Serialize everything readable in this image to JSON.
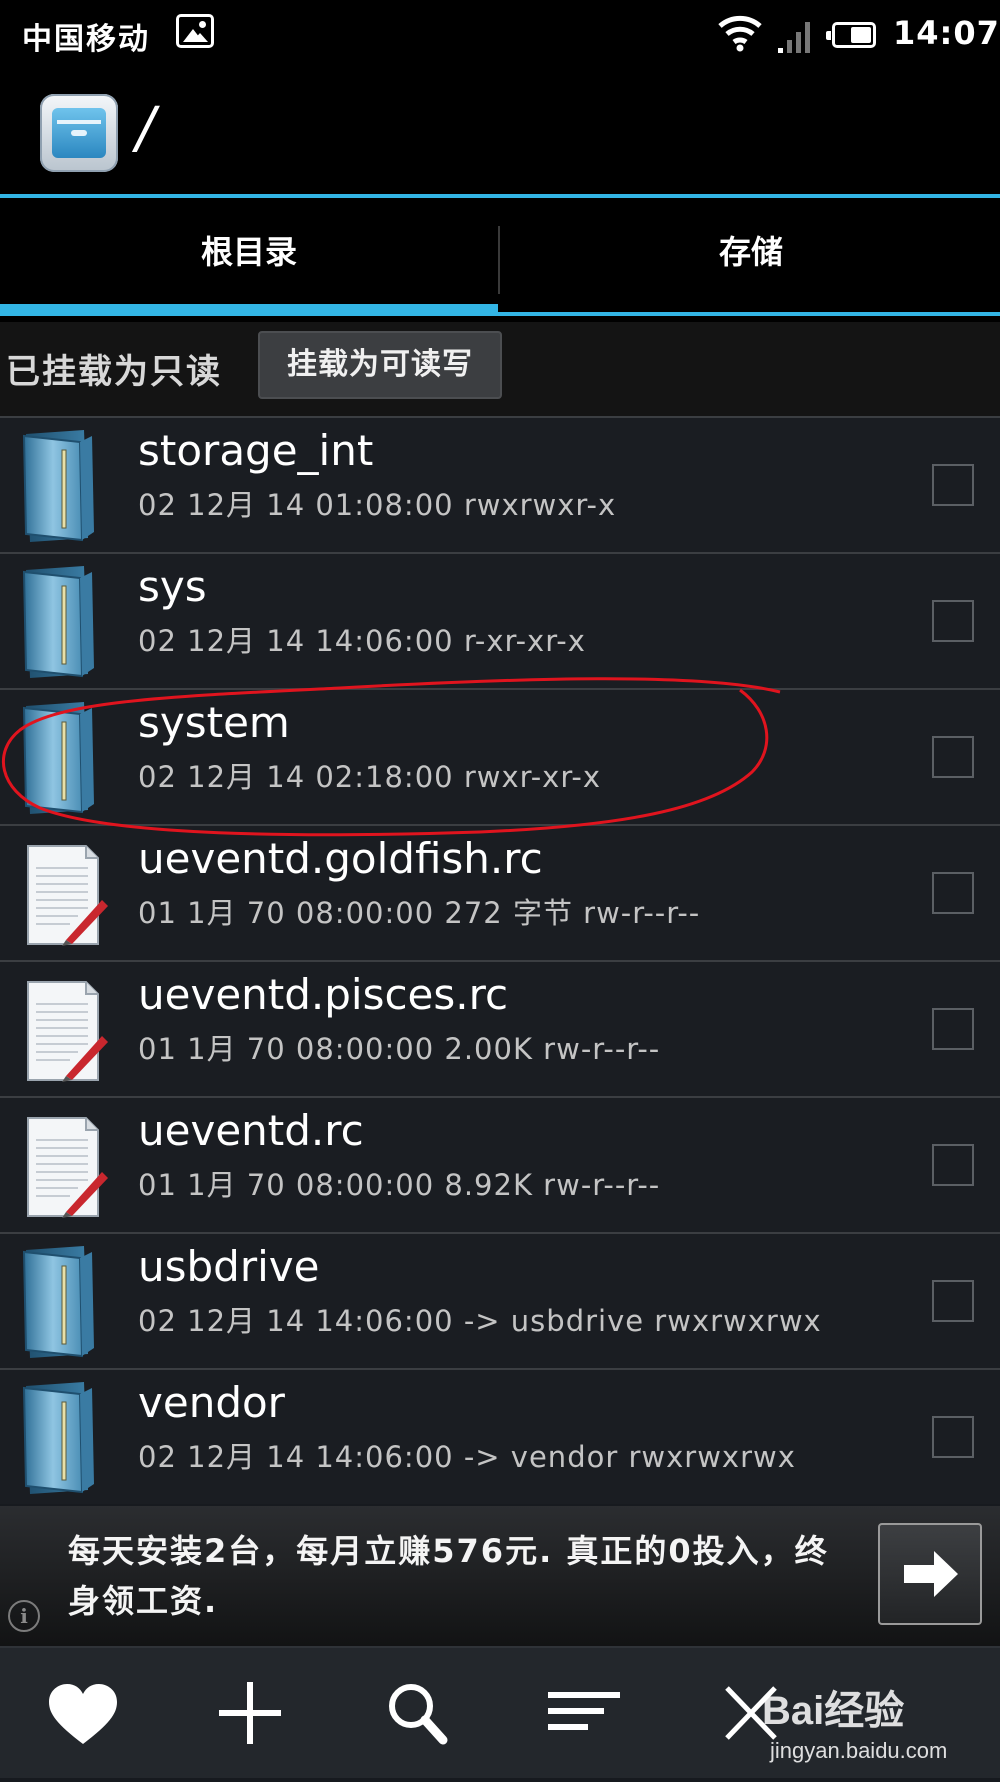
{
  "status_bar": {
    "carrier": "中国移动",
    "time": "14:07",
    "icons": [
      "image-icon",
      "wifi-icon",
      "signal-icon",
      "battery-icon"
    ]
  },
  "action_bar": {
    "path": "/"
  },
  "tabs": [
    {
      "label": "根目录",
      "selected": true
    },
    {
      "label": "存储",
      "selected": false
    }
  ],
  "mount": {
    "status": "已挂载为只读",
    "button": "挂载为可读写"
  },
  "files": [
    {
      "name": "storage_int",
      "meta": "02 12月 14 01:08:00  rwxrwxr-x",
      "type": "folder"
    },
    {
      "name": "sys",
      "meta": "02 12月 14 14:06:00  r-xr-xr-x",
      "type": "folder"
    },
    {
      "name": "system",
      "meta": "02 12月 14 02:18:00  rwxr-xr-x",
      "type": "folder"
    },
    {
      "name": "ueventd.goldfish.rc",
      "meta": "01 1月 70 08:00:00 272 字节 rw-r--r--",
      "type": "file"
    },
    {
      "name": "ueventd.pisces.rc",
      "meta": "01 1月 70 08:00:00 2.00K rw-r--r--",
      "type": "file"
    },
    {
      "name": "ueventd.rc",
      "meta": "01 1月 70 08:00:00 8.92K rw-r--r--",
      "type": "file"
    },
    {
      "name": "usbdrive",
      "meta": "02 12月 14 14:06:00 -> usbdrive rwxrwxrwx",
      "type": "folder"
    },
    {
      "name": "vendor",
      "meta": "02 12月 14 14:06:00 -> vendor rwxrwxrwx",
      "type": "folder"
    }
  ],
  "ad": {
    "text": "每天安装2台，每月立赚576元. 真正的0投入，终身领工资."
  },
  "bottom_bar": {
    "buttons": [
      "heart-icon",
      "add-icon",
      "search-icon",
      "sort-icon"
    ]
  },
  "watermark": {
    "brand": "Bai经验",
    "url": "jingyan.baidu.com"
  },
  "colors": {
    "accent": "#33b5e5",
    "annotation": "#e0141e",
    "background": "#171a1f"
  }
}
